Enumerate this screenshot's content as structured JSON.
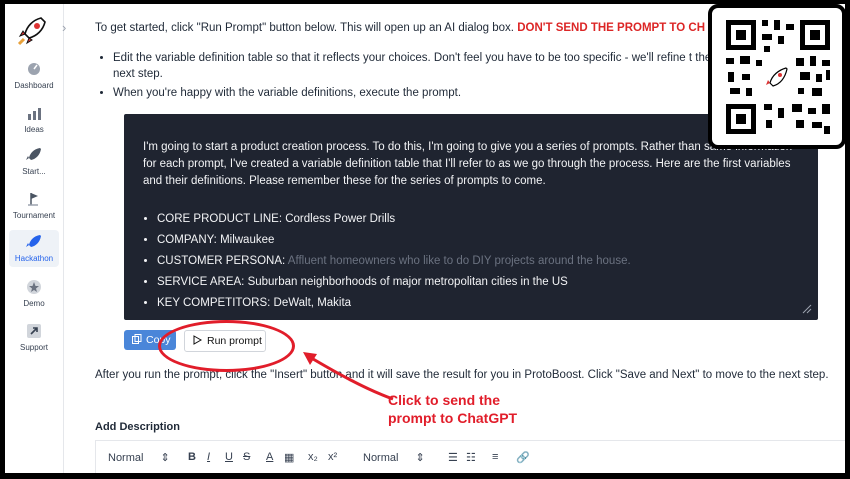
{
  "sidebar": {
    "items": [
      {
        "label": "Dashboard",
        "icon": "dashboard-icon"
      },
      {
        "label": "Ideas",
        "icon": "chart-icon"
      },
      {
        "label": "Start...",
        "icon": "rocket-icon"
      },
      {
        "label": "Tournament",
        "icon": "flag-icon"
      },
      {
        "label": "Hackathon",
        "icon": "rocket-icon"
      },
      {
        "label": "Demo",
        "icon": "star-icon"
      },
      {
        "label": "Support",
        "icon": "arrow-icon"
      }
    ]
  },
  "intro": {
    "text": "To get started, click \"Run Prompt\" button below. This will open up an AI dialog box. ",
    "warning": "DON'T SEND THE PROMPT TO CH"
  },
  "steps": [
    "Edit the variable definition table so that it reflects your choices. Don't feel you have to be too specific - we'll refine t the next step.",
    "When you're happy with the variable definitions, execute the prompt."
  ],
  "prompt": {
    "text": "I'm going to start a product creation process. To do this, I'm going to give you a series of prompts. Rather than same information for each prompt, I've created a variable definition table that I'll refer to as we go through the process. Here are the first variables and their definitions. Please remember these for the series of prompts to come.",
    "variables": [
      {
        "key": "CORE PRODUCT LINE:",
        "value": "Cordless Power Drills",
        "muted": false
      },
      {
        "key": "COMPANY:",
        "value": "Milwaukee",
        "muted": false
      },
      {
        "key": "CUSTOMER PERSONA:",
        "value": "Affluent homeowners who like to do DIY projects around the house.",
        "muted": true
      },
      {
        "key": "SERVICE AREA:",
        "value": "Suburban neighborhoods of major metropolitan cities in the US",
        "muted": false
      },
      {
        "key": "KEY COMPETITORS:",
        "value": "DeWalt, Makita",
        "muted": false
      }
    ]
  },
  "buttons": {
    "copy": "Copy",
    "run": "Run prompt"
  },
  "after_text": "After you run the prompt, click the \"Insert\" button and it will save the result for you in ProtoBoost. Click \"Save and Next\" to move to the next step.",
  "description_label": "Add Description",
  "toolbar": {
    "style1": "Normal",
    "style2": "Normal",
    "bold": "B",
    "italic": "I",
    "underline": "U",
    "strike": "S",
    "color": "A",
    "sub": "x₂",
    "sup": "x²"
  },
  "annotation": {
    "line1": "Click to send the",
    "line2": "prompt to ChatGPT",
    "color": "#e11d2a"
  }
}
